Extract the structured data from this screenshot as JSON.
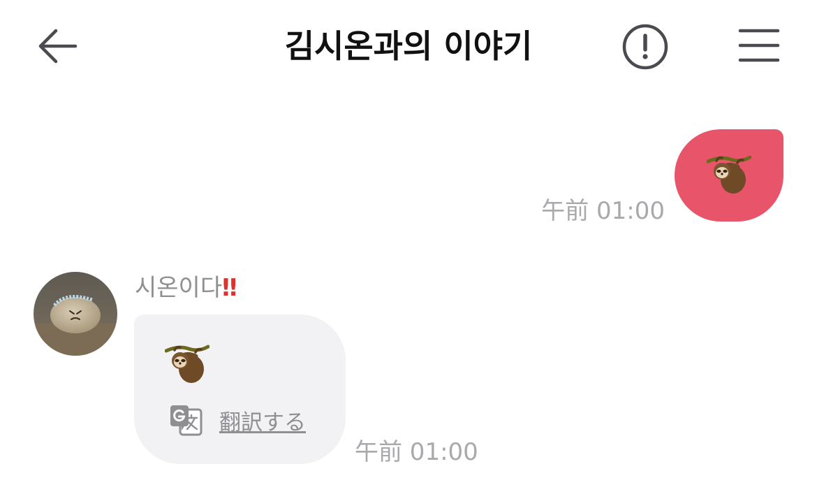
{
  "header": {
    "title": "김시온과의 이야기",
    "back_icon": "arrow-left-icon",
    "report_icon": "exclamation-circle-icon",
    "menu_icon": "hamburger-menu-icon"
  },
  "messages": [
    {
      "direction": "outgoing",
      "content": "sloth-emoji",
      "time": "午前 01:00",
      "bubble_color": "#e8546a"
    },
    {
      "direction": "incoming",
      "sender_name": "시온이다",
      "sender_mark": "‼",
      "content": "sloth-emoji",
      "translate_label": "翻訳する",
      "translate_icon": "translate-icon",
      "time": "午前 01:00",
      "bubble_color": "#f2f2f4"
    }
  ],
  "colors": {
    "outgoing_bubble": "#e8546a",
    "incoming_bubble": "#f2f2f4",
    "timestamp": "#a8a8ad",
    "sender_mark": "#e0322b"
  }
}
